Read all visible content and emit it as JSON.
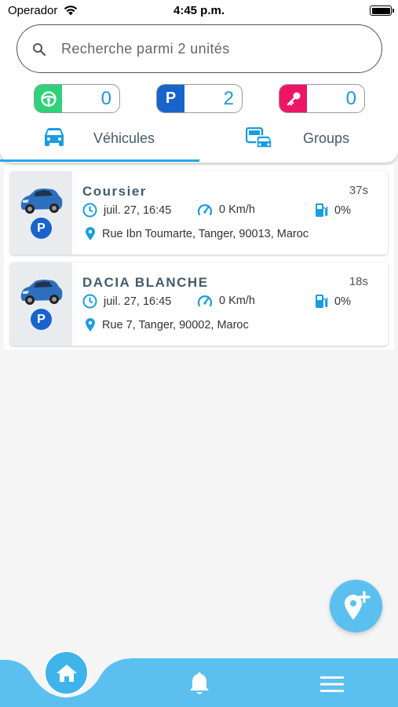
{
  "status_bar": {
    "carrier": "Operador",
    "time": "4:45 p.m."
  },
  "search": {
    "placeholder": "Recherche parmi 2 unités"
  },
  "counters": {
    "moving": {
      "icon": "steering-wheel-icon",
      "value": "0",
      "color": "#2fd179"
    },
    "parked": {
      "icon": "P",
      "value": "2",
      "color": "#1863cc"
    },
    "off": {
      "icon": "key-icon",
      "value": "0",
      "color": "#ec1566"
    }
  },
  "tabs": [
    {
      "label": "Véhicules",
      "icon": "car-icon",
      "active": true
    },
    {
      "label": "Groups",
      "icon": "vehicle-group-icon",
      "active": false
    }
  ],
  "vehicles": [
    {
      "name": "Coursier",
      "age": "37s",
      "date": "juil. 27, 16:45",
      "speed": "0 Km/h",
      "fuel": "0%",
      "address": "Rue Ibn Toumarte, Tanger, 90013, Maroc",
      "status_badge": "P"
    },
    {
      "name": "DACIA BLANCHE",
      "age": "18s",
      "date": "juil. 27, 16:45",
      "speed": "0 Km/h",
      "fuel": "0%",
      "address": "Rue 7, Tanger, 90002, Maroc",
      "status_badge": "P"
    }
  ],
  "colors": {
    "accent": "#29a8e6",
    "bottom_bar": "#5bc0ef",
    "parked": "#1863cc"
  }
}
